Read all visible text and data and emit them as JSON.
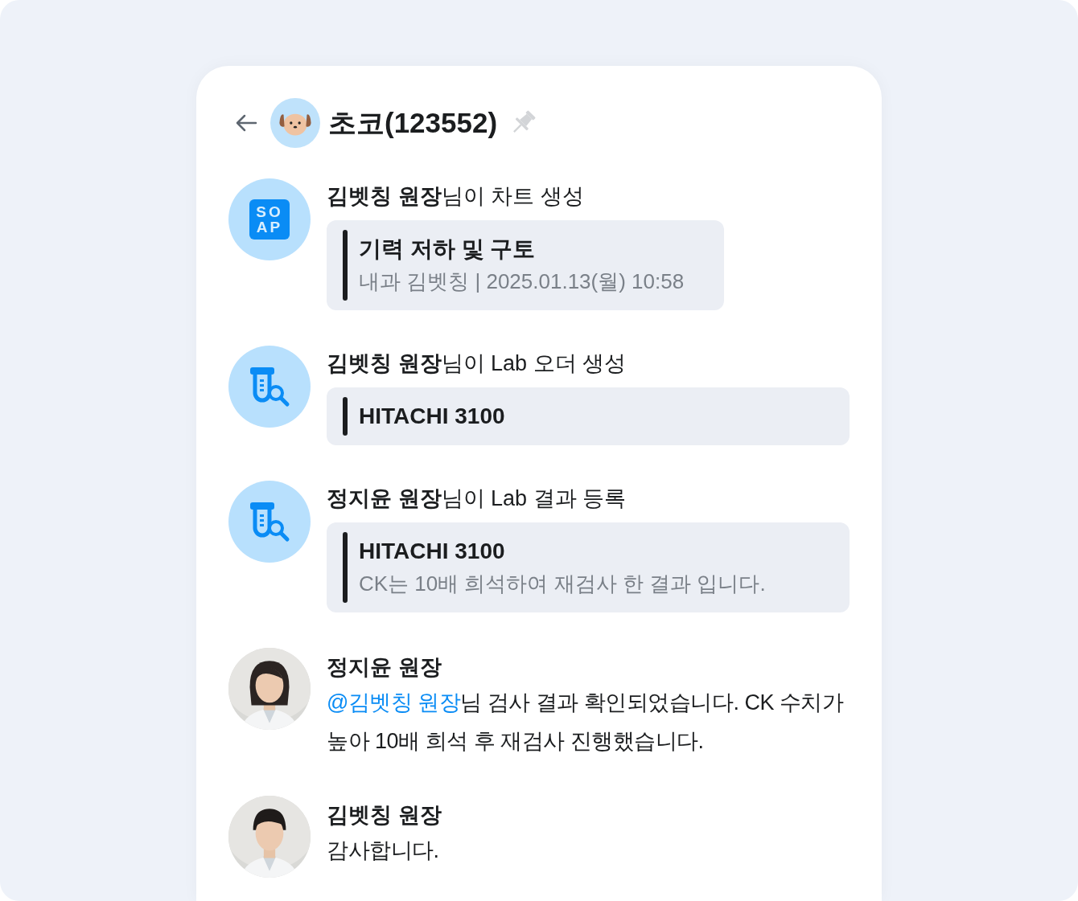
{
  "header": {
    "title": "초코(123552)",
    "pinned": false
  },
  "timeline": [
    {
      "kind": "chart",
      "icon_lines": [
        "SO",
        "AP"
      ],
      "heading": "**김벳칭 원장**님이 차트 생성",
      "card": {
        "title": "기력 저하 및 구토",
        "subtitle": "내과 김벳칭 | 2025.01.13(월) 10:58"
      }
    },
    {
      "kind": "lab",
      "heading": "**김벳칭 원장**님이 Lab 오더 생성",
      "card": {
        "title": "HITACHI 3100"
      }
    },
    {
      "kind": "lab",
      "heading": "**정지윤 원장**님이 Lab 결과 등록",
      "card": {
        "title": "HITACHI 3100",
        "subtitle": "CK는 10배 희석하여 재검사 한 결과 입니다."
      }
    },
    {
      "kind": "message",
      "avatar": {
        "kind": "picture",
        "long_hair": true
      },
      "author": "정지윤 원장",
      "mention": "@김벳칭 원장",
      "text": "님 검사 결과 확인되었습니다. CK 수치가 높아 10배 희석 후 재검사 진행했습니다."
    },
    {
      "kind": "message",
      "avatar": {
        "kind": "picture",
        "long_hair": false
      },
      "author": "김벳칭 원장",
      "text": "감사합니다."
    }
  ]
}
